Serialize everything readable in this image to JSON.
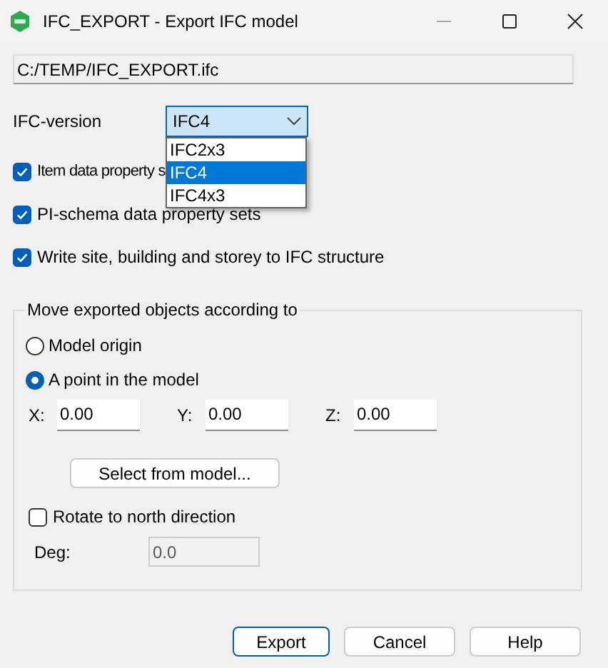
{
  "window": {
    "title": "IFC_EXPORT - Export IFC model"
  },
  "file_path": {
    "value": "C:/TEMP/IFC_EXPORT.ifc"
  },
  "ifc_version": {
    "label": "IFC-version",
    "value": "IFC4",
    "expanded": true,
    "options": [
      {
        "label": "IFC2x3",
        "selected": false
      },
      {
        "label": "IFC4",
        "selected": true
      },
      {
        "label": "IFC4x3",
        "selected": false
      }
    ]
  },
  "checkboxes": [
    {
      "label": "Item data property s",
      "checked": true
    },
    {
      "label": "PI-schema data property sets",
      "checked": true
    },
    {
      "label": "Write site, building and storey to IFC structure",
      "checked": true
    }
  ],
  "group": {
    "title": "Move exported objects according to",
    "radios": [
      {
        "label": "Model origin",
        "selected": false
      },
      {
        "label": "A point in the model",
        "selected": true
      }
    ],
    "coordinates": [
      {
        "label": "X:",
        "value": "0.00"
      },
      {
        "label": "Y:",
        "value": "0.00"
      },
      {
        "label": "Z:",
        "value": "0.00"
      }
    ],
    "select_button": "Select from model...",
    "rotate": {
      "label": "Rotate to north direction",
      "checked": false
    },
    "degree": {
      "label": "Deg:",
      "value": "0.0",
      "disabled": true
    }
  },
  "buttons": [
    {
      "label": "Export",
      "default": true
    },
    {
      "label": "Cancel",
      "default": false
    },
    {
      "label": "Help",
      "default": false
    }
  ]
}
